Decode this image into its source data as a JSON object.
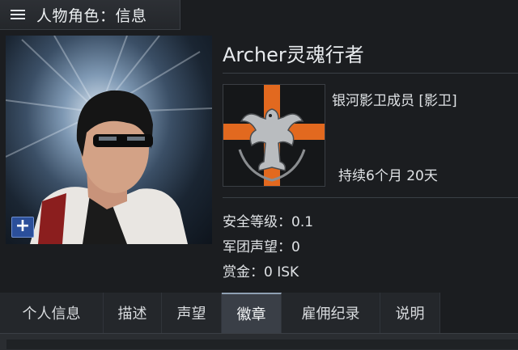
{
  "window": {
    "title": "人物角色：信息",
    "menu_icon": "menu-icon"
  },
  "character": {
    "name": "Archer灵魂行者",
    "corporation": "银河影卫成员 [影卫]",
    "membership_duration": "持续6个月 20天",
    "security_status": "安全等级：0.1",
    "corp_standing": "军团声望：0",
    "bounty": "赏金：0 ISK"
  },
  "tabs": [
    {
      "label": "个人信息",
      "active": false
    },
    {
      "label": "描述",
      "active": false
    },
    {
      "label": "声望",
      "active": false
    },
    {
      "label": "徽章",
      "active": true
    },
    {
      "label": "雇佣纪录",
      "active": false
    },
    {
      "label": "说明",
      "active": false
    }
  ],
  "colors": {
    "corp_cross": "#e2691f",
    "active_tab": "#3a3f47",
    "plus_button": "#2b4f9a"
  }
}
